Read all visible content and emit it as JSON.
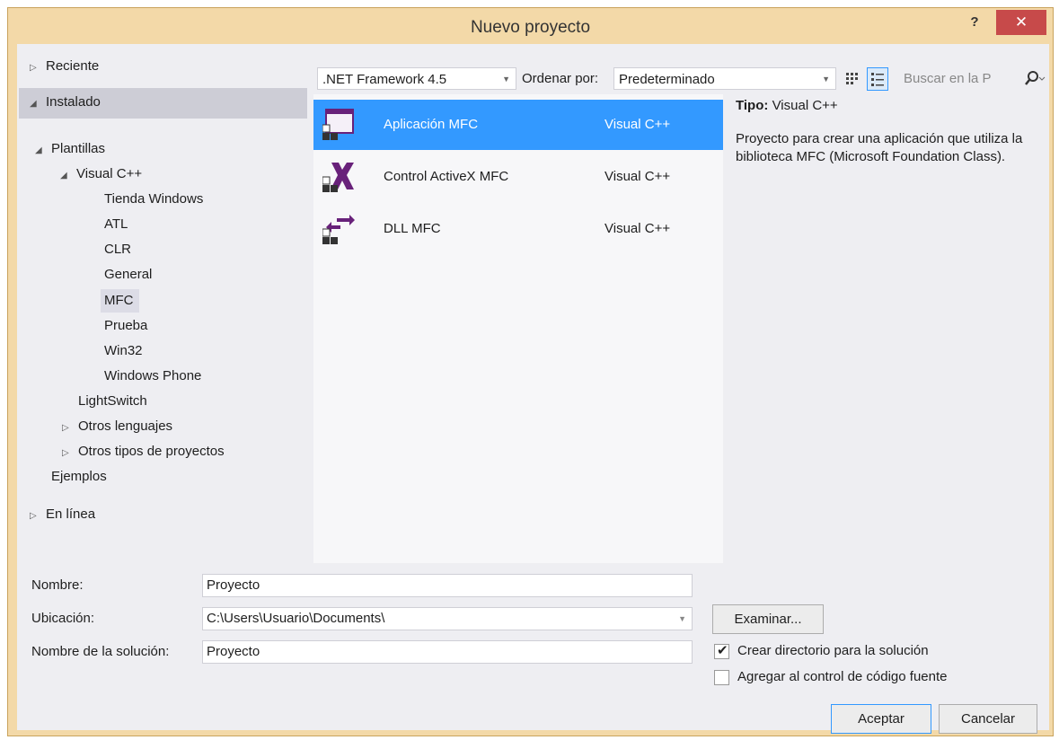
{
  "window": {
    "title": "Nuevo proyecto",
    "help_label": "?",
    "close_label": "✕"
  },
  "tree": {
    "recent": "Reciente",
    "installed": "Instalado",
    "templates": "Plantillas",
    "visual_cpp": "Visual C++",
    "children": [
      "Tienda Windows",
      "ATL",
      "CLR",
      "General",
      "MFC",
      "Prueba",
      "Win32",
      "Windows Phone"
    ],
    "selected_child": "MFC",
    "lightswitch": "LightSwitch",
    "other_languages": "Otros lenguajes",
    "other_project_types": "Otros tipos de proyectos",
    "samples": "Ejemplos",
    "online": "En línea"
  },
  "toolbar": {
    "framework": ".NET Framework 4.5",
    "sort_label": "Ordenar por:",
    "sort_value": "Predeterminado",
    "search_placeholder": "Buscar en la P"
  },
  "templates": [
    {
      "name": "Aplicación MFC",
      "language": "Visual C++",
      "selected": true,
      "icon": "mfc-app-icon"
    },
    {
      "name": "Control ActiveX MFC",
      "language": "Visual C++",
      "selected": false,
      "icon": "mfc-activex-icon"
    },
    {
      "name": "DLL MFC",
      "language": "Visual C++",
      "selected": false,
      "icon": "mfc-dll-icon"
    }
  ],
  "info": {
    "type_label": "Tipo:",
    "type_value": "Visual C++",
    "description": "Proyecto para crear una aplicación que utiliza la biblioteca MFC (Microsoft Foundation Class)."
  },
  "form": {
    "name_label": "Nombre:",
    "name_value": "Proyecto",
    "location_label": "Ubicación:",
    "location_value": "C:\\Users\\Usuario\\Documents\\",
    "solution_label": "Nombre de la solución:",
    "solution_value": "Proyecto",
    "browse_label": "Examinar...",
    "create_dir_label": "Crear directorio para la solución",
    "create_dir_checked": true,
    "source_control_label": "Agregar al control de código fuente",
    "source_control_checked": false,
    "ok_label": "Aceptar",
    "cancel_label": "Cancelar"
  },
  "colors": {
    "accent": "#3399ff",
    "mfc_purple": "#68217a",
    "close_red": "#c74a4a"
  }
}
